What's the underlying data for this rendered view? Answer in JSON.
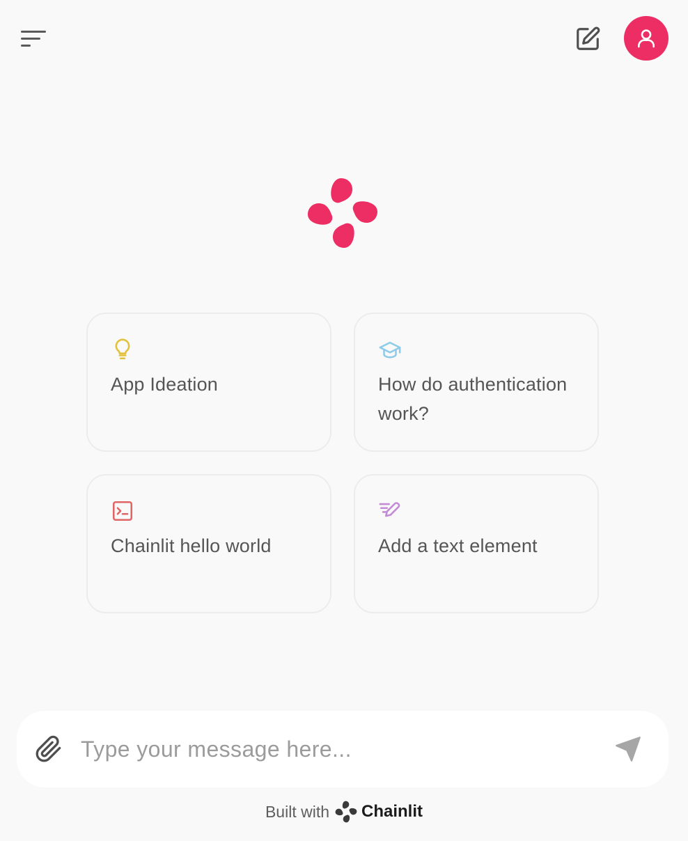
{
  "header": {
    "menu_icon": "sidebar-menu-icon",
    "new_chat_icon": "edit-icon",
    "avatar_icon": "user-icon",
    "avatar_color": "#ec2e64"
  },
  "logo": {
    "icon": "chainlit-logo",
    "color": "#ec2e64"
  },
  "starters": [
    {
      "label": "App Ideation",
      "icon": "lightbulb-icon",
      "icon_color": "#e2c23c"
    },
    {
      "label": "How do authentication work?",
      "icon": "graduation-cap-icon",
      "icon_color": "#8ecbe8"
    },
    {
      "label": "Chainlit hello world",
      "icon": "terminal-icon",
      "icon_color": "#e06666"
    },
    {
      "label": "Add a text element",
      "icon": "pen-lines-icon",
      "icon_color": "#c38ad6"
    }
  ],
  "composer": {
    "placeholder": "Type your message here...",
    "value": "",
    "attach_icon": "paperclip-icon",
    "send_icon": "send-icon"
  },
  "footer": {
    "built_with": "Built with",
    "brand": "Chainlit"
  }
}
